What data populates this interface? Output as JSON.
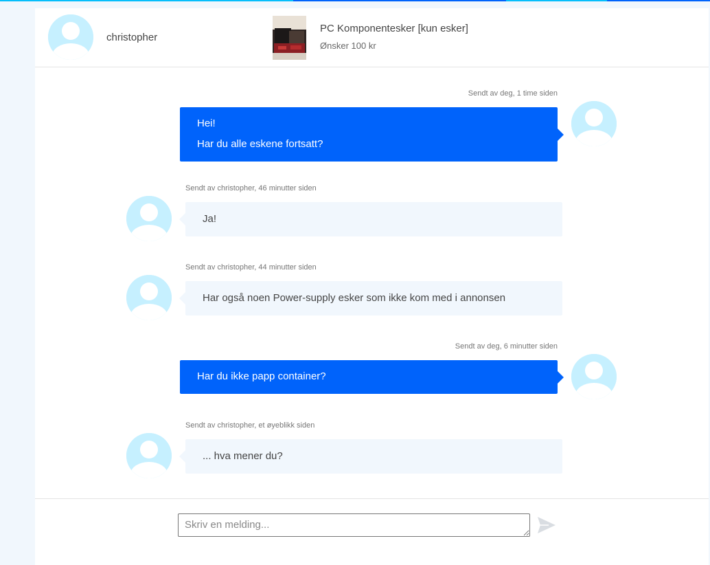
{
  "header": {
    "username": "christopher",
    "listing_title": "PC Komponentesker [kun esker]",
    "listing_price": "Ønsker 100 kr"
  },
  "messages": [
    {
      "direction": "outgoing",
      "meta": "Sendt av deg, 1 time siden",
      "lines": [
        "Hei!",
        "Har du alle eskene fortsatt?"
      ]
    },
    {
      "direction": "incoming",
      "meta": "Sendt av christopher, 46 minutter siden",
      "lines": [
        "Ja!"
      ]
    },
    {
      "direction": "incoming",
      "meta": "Sendt av christopher, 44 minutter siden",
      "lines": [
        "Har også noen Power-supply esker som ikke kom med i annonsen"
      ]
    },
    {
      "direction": "outgoing",
      "meta": "Sendt av deg, 6 minutter siden",
      "lines": [
        "Har du ikke papp container?"
      ]
    },
    {
      "direction": "incoming",
      "meta": "Sendt av christopher, et øyeblikk siden",
      "lines": [
        "... hva mener du?"
      ]
    }
  ],
  "composer": {
    "placeholder": "Skriv en melding...",
    "value": ""
  },
  "icons": {
    "send": "send-icon",
    "avatar": "user-silhouette-icon"
  },
  "colors": {
    "accent": "#0063fb",
    "accent_light": "#06befb",
    "avatar_bg": "#c6f0ff",
    "incoming_bubble": "#f1f7fd",
    "send_icon": "#d9dde2"
  }
}
